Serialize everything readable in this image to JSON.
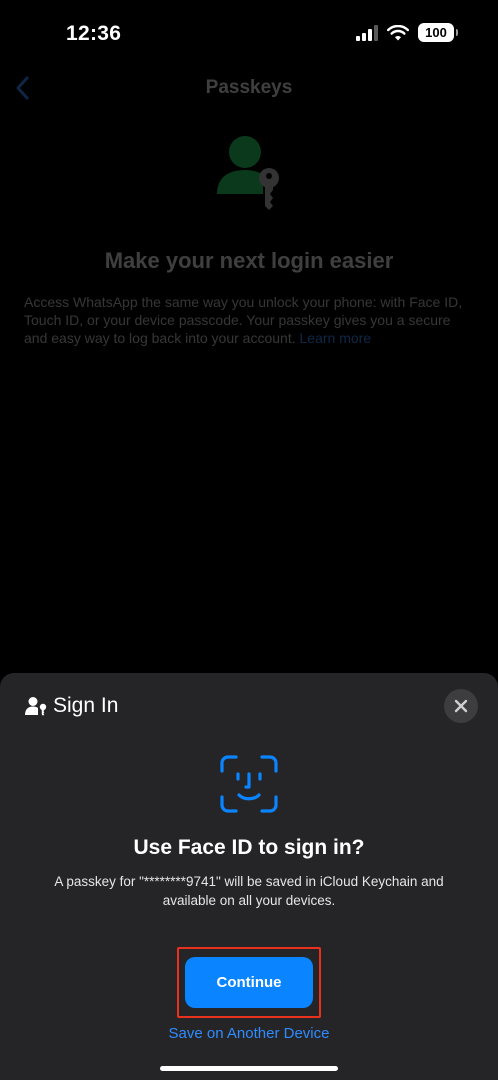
{
  "status_bar": {
    "time": "12:36",
    "battery": "100"
  },
  "background_page": {
    "nav_title": "Passkeys",
    "headline": "Make your next login easier",
    "description": "Access WhatsApp the same way you unlock your phone: with Face ID, Touch ID, or your device passcode. Your passkey gives you a secure and easy way to log back into your account.",
    "learn_more": "Learn more"
  },
  "sheet": {
    "header_label": "Sign In",
    "title": "Use Face ID to sign in?",
    "description": "A passkey for \"********9741\" will be saved in iCloud Keychain and available on all your devices.",
    "continue_label": "Continue",
    "alt_option_label": "Save on Another Device"
  },
  "colors": {
    "accent": "#0a84ff",
    "highlight": "#e8321e",
    "sheet_bg": "#252527",
    "whatsapp_green": "#25d366"
  }
}
